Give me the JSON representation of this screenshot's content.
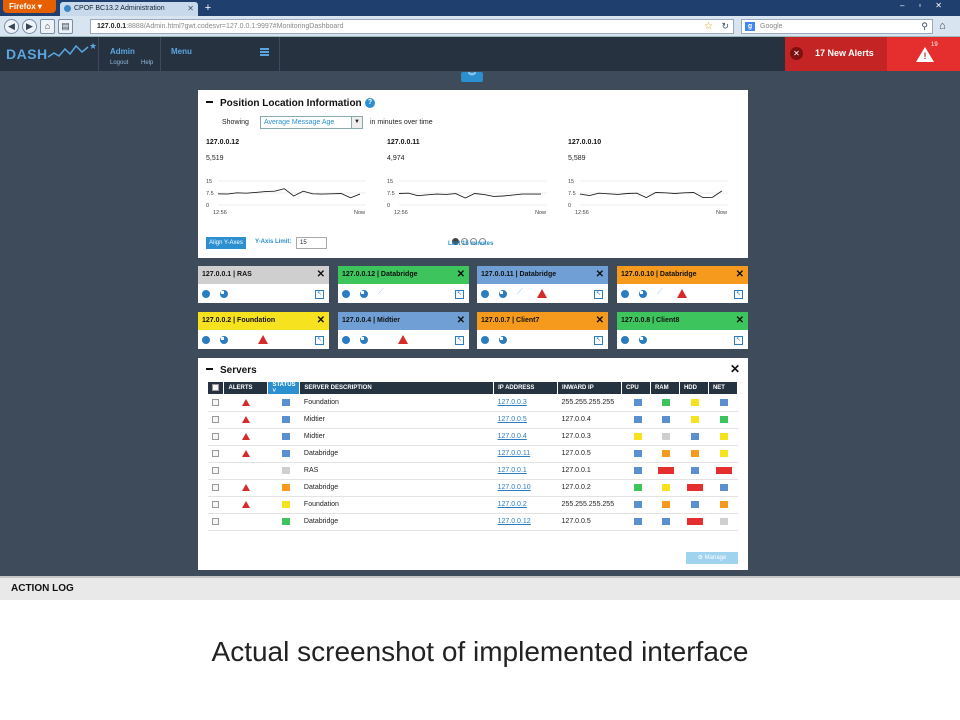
{
  "browser": {
    "app_button": "Firefox",
    "tab_title": "CPOF BC13.2 Administration",
    "url_host": "127.0.0.1",
    "url_rest": ":8888/Admin.html?gwt.codesvr=127.0.0.1:9997#MonitoringDashboard",
    "search_placeholder": "Google"
  },
  "header": {
    "logo": "DASH",
    "user": "Admin",
    "logout": "Logout",
    "help": "Help",
    "menu": "Menu",
    "alerts_label": "17 New Alerts",
    "alerts_count": "19"
  },
  "position_panel": {
    "title": "Position Location Information",
    "showing_label": "Showing",
    "selected_metric": "Average Message Age",
    "suffix": "in minutes over time",
    "charts": [
      {
        "ip": "127.0.0.12",
        "value": "5,519",
        "y_ticks": [
          "15",
          "7.5",
          "0"
        ],
        "x_ticks": [
          "12:56",
          "Now"
        ],
        "series": [
          7.0,
          6.8,
          7.6,
          7.4,
          7.9,
          8.4,
          8.6,
          10.2,
          5.6,
          8.6,
          7.0,
          6.8,
          7.0,
          7.2,
          4.5,
          6.8
        ]
      },
      {
        "ip": "127.0.0.11",
        "value": "4,974",
        "y_ticks": [
          "15",
          "7.5",
          "0"
        ],
        "x_ticks": [
          "12:56",
          "Now"
        ],
        "series": [
          7.2,
          7.4,
          5.8,
          6.4,
          6.8,
          6.6,
          7.1,
          4.4,
          7.2,
          6.5,
          5.4,
          5.6,
          6.2,
          6.8,
          6.8,
          6.8
        ]
      },
      {
        "ip": "127.0.0.10",
        "value": "5,589",
        "y_ticks": [
          "15",
          "7.5",
          "0"
        ],
        "x_ticks": [
          "12:56",
          "Now"
        ],
        "series": [
          6.8,
          5.9,
          7.4,
          7.0,
          6.6,
          7.2,
          7.4,
          4.6,
          7.8,
          7.6,
          7.2,
          7.6,
          7.8,
          4.6,
          4.8,
          8.8
        ]
      }
    ],
    "align_button": "Align Y-Axes",
    "ylimit_label": "Y-Axis Limit:",
    "ylimit_value": "15",
    "range_label": "Last 15 minutes"
  },
  "tiles": [
    {
      "title": "127.0.0.1 | RAS",
      "color": "#cfcfcf",
      "icons": [
        "gear",
        "pie"
      ]
    },
    {
      "title": "127.0.0.12 | Databridge",
      "color": "#3dc45c",
      "icons": [
        "gear",
        "pie",
        "wave"
      ]
    },
    {
      "title": "127.0.0.11 | Databridge",
      "color": "#6f9fd4",
      "icons": [
        "gear",
        "pie",
        "wave",
        "alert"
      ]
    },
    {
      "title": "127.0.0.10 | Databridge",
      "color": "#f59a1c",
      "icons": [
        "gear",
        "pie",
        "wave",
        "alert"
      ]
    },
    {
      "title": "127.0.0.2 | Foundation",
      "color": "#f6e21f",
      "icons": [
        "gear",
        "pie",
        "alert"
      ]
    },
    {
      "title": "127.0.0.4 | Midtier",
      "color": "#6f9fd4",
      "icons": [
        "gear",
        "pie",
        "alert"
      ]
    },
    {
      "title": "127.0.0.7 | Client7",
      "color": "#f59a1c",
      "icons": [
        "gear",
        "pie"
      ]
    },
    {
      "title": "127.0.0.8 | Client8",
      "color": "#3dc45c",
      "icons": [
        "gear",
        "pie"
      ]
    }
  ],
  "servers": {
    "title": "Servers",
    "columns": [
      "ALERTS",
      "STATUS",
      "SERVER DESCRIPTION",
      "IP ADDRESS",
      "INWARD IP",
      "CPU",
      "RAM",
      "HDD",
      "NET"
    ],
    "rows": [
      {
        "alert": true,
        "status": "#5b8fd0",
        "desc": "Foundation",
        "ip": "127.0.0.3",
        "inward": "255.255.255.255",
        "cpu": "#5b8fd0",
        "ram": "#3dc45c",
        "hdd": "#f6e21f",
        "net": "#5b8fd0"
      },
      {
        "alert": true,
        "status": "#5b8fd0",
        "desc": "Midtier",
        "ip": "127.0.0.5",
        "inward": "127.0.0.4",
        "cpu": "#5b8fd0",
        "ram": "#5b8fd0",
        "hdd": "#f6e21f",
        "net": "#3dc45c"
      },
      {
        "alert": true,
        "status": "#5b8fd0",
        "desc": "Midtier",
        "ip": "127.0.0.4",
        "inward": "127.0.0.3",
        "cpu": "#f6e21f",
        "ram": "#cfcfcf",
        "hdd": "#5b8fd0",
        "net": "#f6e21f"
      },
      {
        "alert": true,
        "status": "#5b8fd0",
        "desc": "Databridge",
        "ip": "127.0.0.11",
        "inward": "127.0.0.5",
        "cpu": "#5b8fd0",
        "ram": "#f59a1c",
        "hdd": "#f59a1c",
        "net": "#f6e21f"
      },
      {
        "alert": false,
        "status": "#cfcfcf",
        "desc": "RAS",
        "ip": "127.0.0.1",
        "inward": "127.0.0.1",
        "cpu": "#5b8fd0",
        "ram": "#e52f2f",
        "hdd": "#5b8fd0",
        "net": "#e52f2f"
      },
      {
        "alert": true,
        "status": "#f59a1c",
        "desc": "Databridge",
        "ip": "127.0.0.10",
        "inward": "127.0.0.2",
        "cpu": "#3dc45c",
        "ram": "#f6e21f",
        "hdd": "#e52f2f",
        "net": "#5b8fd0"
      },
      {
        "alert": true,
        "status": "#f6e21f",
        "desc": "Foundation",
        "ip": "127.0.0.2",
        "inward": "255.255.255.255",
        "cpu": "#5b8fd0",
        "ram": "#f59a1c",
        "hdd": "#5b8fd0",
        "net": "#f59a1c"
      },
      {
        "alert": false,
        "status": "#3dc45c",
        "desc": "Databridge",
        "ip": "127.0.0.12",
        "inward": "127.0.0.5",
        "cpu": "#5b8fd0",
        "ram": "#5b8fd0",
        "hdd": "#e52f2f",
        "net": "#cfcfcf"
      }
    ],
    "wide_cells": [
      [
        4,
        "ram"
      ],
      [
        4,
        "net"
      ],
      [
        5,
        "hdd"
      ],
      [
        7,
        "hdd"
      ]
    ],
    "manage_button": "Manage"
  },
  "action_log": "ACTION LOG",
  "caption": "Actual screenshot of implemented interface"
}
